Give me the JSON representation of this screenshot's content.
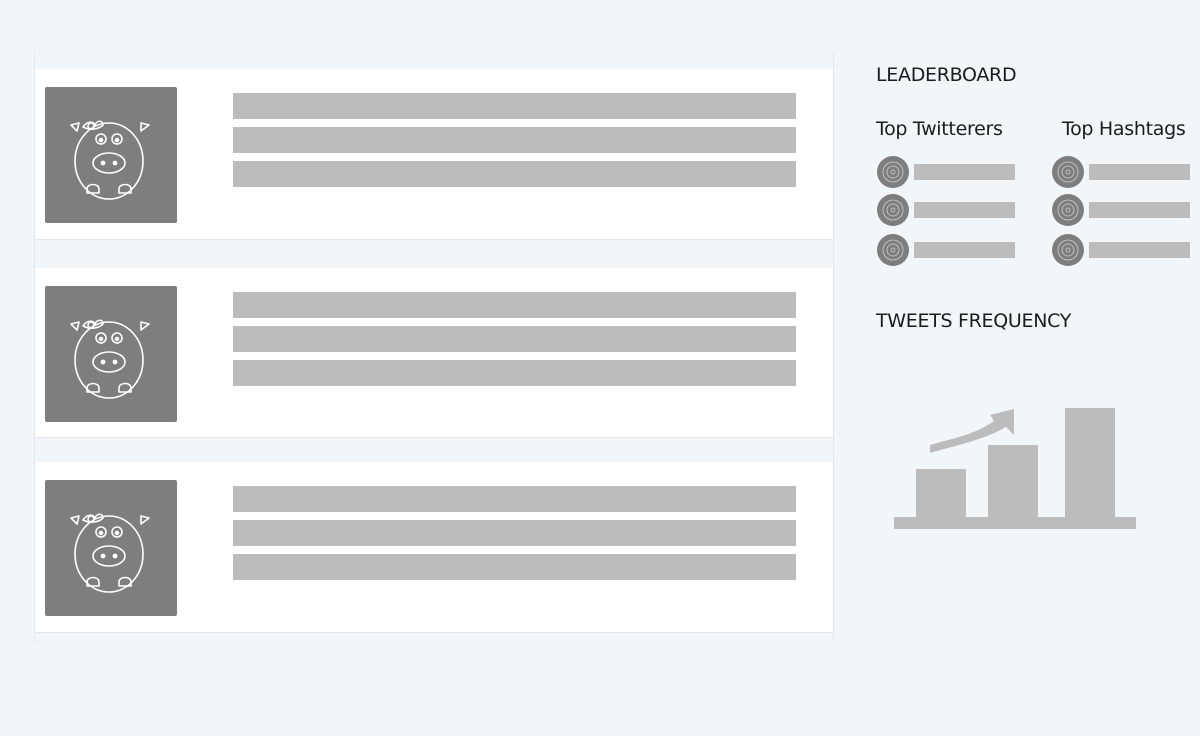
{
  "sidebar": {
    "leaderboard_title": "LEADERBOARD",
    "top_twitterers_title": "Top Twitterers",
    "top_hashtags_title": "Top Hashtags",
    "tweets_frequency_title": "TWEETS FREQUENCY"
  },
  "feed": {
    "placeholder_count": 3,
    "placeholder_color": "#bcbcbc",
    "avatar_color": "#7e7e7e"
  },
  "icons": {
    "avatar": "cow-avatar-icon",
    "leaderboard_entry": "avatar-placeholder-icon",
    "chart": "growth-chart-icon"
  },
  "colors": {
    "background": "#f3f6f9",
    "card": "#ffffff",
    "placeholder": "#bcbcbc",
    "avatar": "#7e7e7e"
  }
}
